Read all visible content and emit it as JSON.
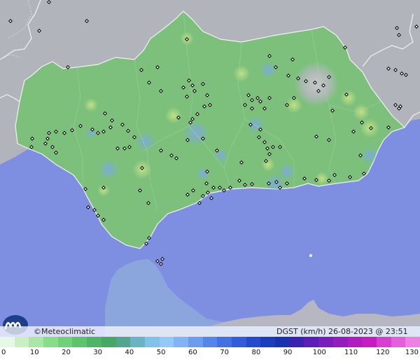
{
  "branding": {
    "name": "Meteoclimatic",
    "symbol": "©"
  },
  "product": "DGST (km/h)",
  "timestamp": "26-08-2023 @ 23:51 UTC",
  "scale": {
    "ticks": [
      "0",
      "10",
      "20",
      "30",
      "40",
      "50",
      "60",
      "70",
      "80",
      "90",
      "100",
      "110",
      "120",
      "130"
    ],
    "colors": [
      "#e7f8e4",
      "#c9f0c3",
      "#a8e7a6",
      "#88dd8a",
      "#6fd27a",
      "#5cc46d",
      "#4eb466",
      "#47a765",
      "#53a58d",
      "#68b4c5",
      "#80c2ea",
      "#93c9f8",
      "#80b4f4",
      "#6b9cf0",
      "#5685ea",
      "#4370e3",
      "#325cd9",
      "#244bcd",
      "#1c3dbd",
      "#1833ad",
      "#3a22b3",
      "#5b1fb8",
      "#7a1ebb",
      "#961dbd",
      "#b01cc0",
      "#c61dc2",
      "#d83fd0",
      "#e45fdc",
      "#ee80e5"
    ]
  },
  "colors": {
    "sea": "#7e8ee0",
    "land_outside": "#b1b4bb",
    "andalusia": "#7cc07c",
    "morocco": "#8aa6dc"
  }
}
